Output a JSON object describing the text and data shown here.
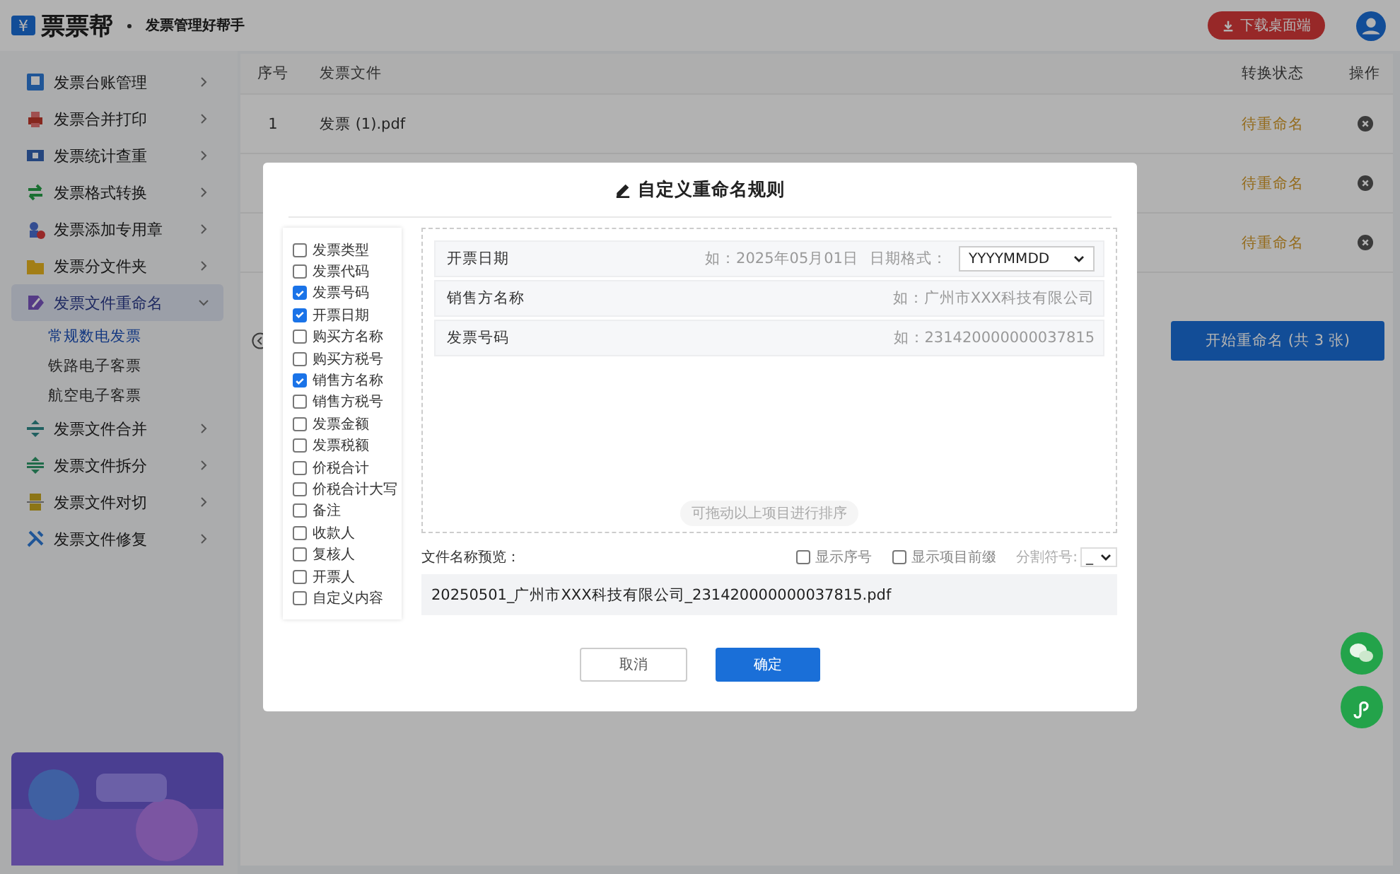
{
  "header": {
    "logo_glyph": "¥",
    "brand": "票票帮",
    "tagline": "发票管理好帮手",
    "download": "下载桌面端"
  },
  "sidebar": {
    "items": [
      {
        "label": "发票台账管理",
        "selected": false,
        "expanded": false
      },
      {
        "label": "发票合并打印",
        "selected": false,
        "expanded": false
      },
      {
        "label": "发票统计查重",
        "selected": false,
        "expanded": false
      },
      {
        "label": "发票格式转换",
        "selected": false,
        "expanded": false
      },
      {
        "label": "发票添加专用章",
        "selected": false,
        "expanded": false
      },
      {
        "label": "发票分文件夹",
        "selected": false,
        "expanded": false
      },
      {
        "label": "发票文件重命名",
        "selected": true,
        "expanded": true,
        "children": [
          {
            "label": "常规数电发票",
            "selected": true
          },
          {
            "label": "铁路电子客票",
            "selected": false
          },
          {
            "label": "航空电子客票",
            "selected": false
          }
        ]
      },
      {
        "label": "发票文件合并",
        "selected": false,
        "expanded": false
      },
      {
        "label": "发票文件拆分",
        "selected": false,
        "expanded": false
      },
      {
        "label": "发票文件对切",
        "selected": false,
        "expanded": false
      },
      {
        "label": "发票文件修复",
        "selected": false,
        "expanded": false
      }
    ]
  },
  "table": {
    "columns": [
      "序号",
      "发票文件",
      "转换状态",
      "操作"
    ],
    "rows": [
      {
        "index": "1",
        "file": "发票 (1).pdf",
        "status": "待重命名"
      },
      {
        "status": "待重命名"
      },
      {
        "status": "待重命名"
      }
    ]
  },
  "start_button": "开始重命名 (共 3 张)",
  "dialog": {
    "title": "自定义重命名规则",
    "fields": [
      {
        "label": "发票类型",
        "checked": false
      },
      {
        "label": "发票代码",
        "checked": false
      },
      {
        "label": "发票号码",
        "checked": true
      },
      {
        "label": "开票日期",
        "checked": true
      },
      {
        "label": "购买方名称",
        "checked": false
      },
      {
        "label": "购买方税号",
        "checked": false
      },
      {
        "label": "销售方名称",
        "checked": true
      },
      {
        "label": "销售方税号",
        "checked": false
      },
      {
        "label": "发票金额",
        "checked": false
      },
      {
        "label": "发票税额",
        "checked": false
      },
      {
        "label": "价税合计",
        "checked": false
      },
      {
        "label": "价税合计大写",
        "checked": false
      },
      {
        "label": "备注",
        "checked": false
      },
      {
        "label": "收款人",
        "checked": false
      },
      {
        "label": "复核人",
        "checked": false
      },
      {
        "label": "开票人",
        "checked": false
      },
      {
        "label": "自定义内容",
        "checked": false
      }
    ],
    "sort_items": [
      {
        "kind": "date",
        "label": "开票日期",
        "example": "如：2025年05月01日",
        "format_label": "日期格式：",
        "format": "YYYYMMDD"
      },
      {
        "kind": "text",
        "label": "销售方名称",
        "example": "如：广州市XXX科技有限公司"
      },
      {
        "kind": "text",
        "label": "发票号码",
        "example": "如：231420000000037815"
      }
    ],
    "sort_hint": "可拖动以上项目进行排序",
    "preview_label": "文件名称预览：",
    "options": [
      {
        "label": "显示序号",
        "checked": false
      },
      {
        "label": "显示项目前缀",
        "checked": false
      }
    ],
    "separator_label": "分割符号:",
    "separator": "_",
    "preview": "20250501_广州市XXX科技有限公司_231420000000037815.pdf",
    "cancel": "取消",
    "ok": "确定"
  }
}
